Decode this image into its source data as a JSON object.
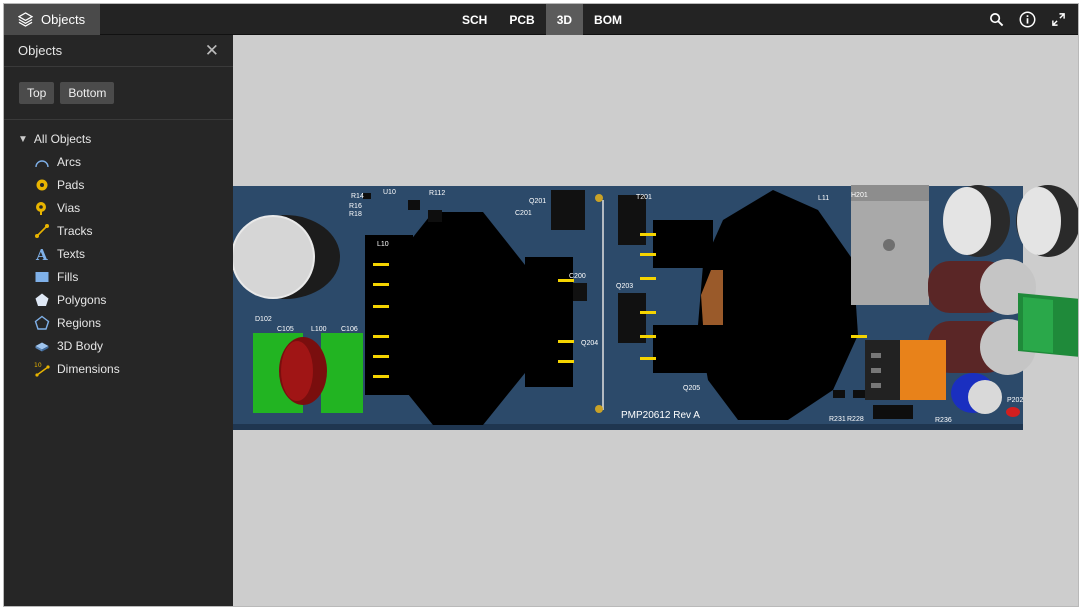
{
  "topbar": {
    "objects_label": "Objects",
    "tabs": [
      {
        "label": "SCH",
        "active": false
      },
      {
        "label": "PCB",
        "active": false
      },
      {
        "label": "3D",
        "active": true
      },
      {
        "label": "BOM",
        "active": false
      }
    ],
    "icons": [
      "search-icon",
      "info-icon",
      "fullscreen-icon"
    ]
  },
  "sidebar": {
    "title": "Objects",
    "buttons": {
      "top": "Top",
      "bottom": "Bottom"
    },
    "root_label": "All Objects",
    "items": [
      {
        "label": "Arcs",
        "icon": "arc-icon"
      },
      {
        "label": "Pads",
        "icon": "pad-icon"
      },
      {
        "label": "Vias",
        "icon": "via-icon"
      },
      {
        "label": "Tracks",
        "icon": "track-icon"
      },
      {
        "label": "Texts",
        "icon": "text-icon"
      },
      {
        "label": "Fills",
        "icon": "fill-icon"
      },
      {
        "label": "Polygons",
        "icon": "polygon-icon"
      },
      {
        "label": "Regions",
        "icon": "region-icon"
      },
      {
        "label": "3D Body",
        "icon": "3d-body-icon"
      },
      {
        "label": "Dimensions",
        "icon": "dimension-icon"
      }
    ]
  },
  "board": {
    "title": "PMP20612 Rev A",
    "refs": [
      "C105",
      "L100",
      "C106",
      "D102",
      "C200",
      "Q204",
      "Q203",
      "T201",
      "H201",
      "Q205",
      "R231",
      "R228",
      "R236",
      "P202",
      "C201",
      "Q201",
      "L11",
      "R112",
      "R14",
      "R16",
      "R18",
      "U10",
      "L10"
    ]
  },
  "colors": {
    "topbar": "#232323",
    "sidebar": "#262626",
    "active_tab": "#5b5b5b",
    "pcb": "#2c4a6a",
    "viewport_bg": "#cdcdcd"
  }
}
